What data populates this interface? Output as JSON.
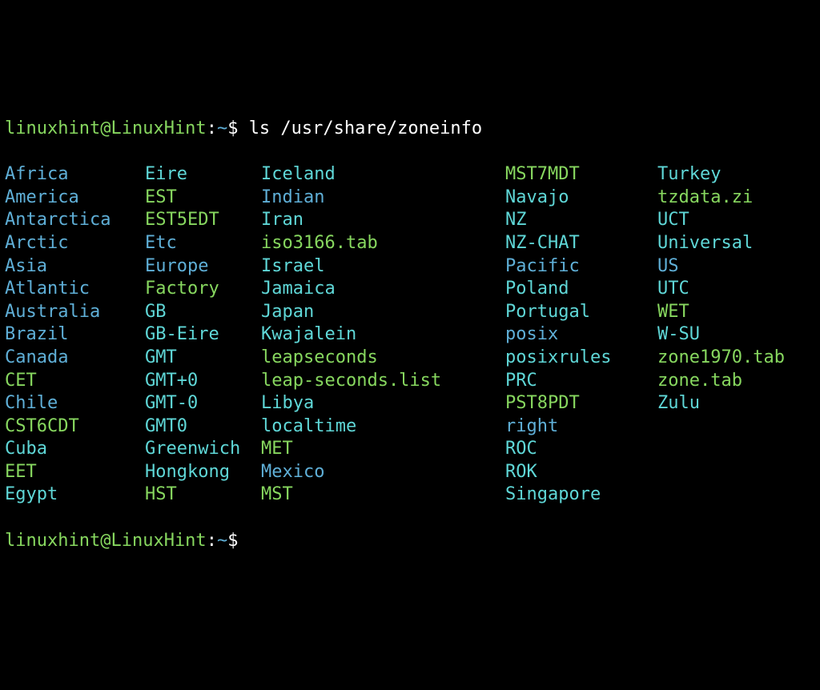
{
  "prompt": {
    "user": "linuxhint",
    "at": "@",
    "host": "LinuxHint",
    "colon": ":",
    "path": "~",
    "dollar": "$ ",
    "command": "ls /usr/share/zoneinfo"
  },
  "prompt2": {
    "user": "linuxhint",
    "at": "@",
    "host": "LinuxHint",
    "colon": ":",
    "path": "~",
    "dollar": "$"
  },
  "r": [
    {
      "c1": {
        "t": "Africa",
        "k": "blue"
      },
      "c2": {
        "t": "Eire",
        "k": "teal"
      },
      "c3": {
        "t": "Iceland",
        "k": "teal"
      },
      "c4": {
        "t": "MST7MDT",
        "k": "green"
      },
      "c5": {
        "t": "Turkey",
        "k": "teal"
      }
    },
    {
      "c1": {
        "t": "America",
        "k": "blue"
      },
      "c2": {
        "t": "EST",
        "k": "green"
      },
      "c3": {
        "t": "Indian",
        "k": "blue"
      },
      "c4": {
        "t": "Navajo",
        "k": "teal"
      },
      "c5": {
        "t": "tzdata.zi",
        "k": "green"
      }
    },
    {
      "c1": {
        "t": "Antarctica",
        "k": "blue"
      },
      "c2": {
        "t": "EST5EDT",
        "k": "green"
      },
      "c3": {
        "t": "Iran",
        "k": "teal"
      },
      "c4": {
        "t": "NZ",
        "k": "teal"
      },
      "c5": {
        "t": "UCT",
        "k": "teal"
      }
    },
    {
      "c1": {
        "t": "Arctic",
        "k": "blue"
      },
      "c2": {
        "t": "Etc",
        "k": "blue"
      },
      "c3": {
        "t": "iso3166.tab",
        "k": "green"
      },
      "c4": {
        "t": "NZ-CHAT",
        "k": "teal"
      },
      "c5": {
        "t": "Universal",
        "k": "teal"
      }
    },
    {
      "c1": {
        "t": "Asia",
        "k": "blue"
      },
      "c2": {
        "t": "Europe",
        "k": "blue"
      },
      "c3": {
        "t": "Israel",
        "k": "teal"
      },
      "c4": {
        "t": "Pacific",
        "k": "blue"
      },
      "c5": {
        "t": "US",
        "k": "blue"
      }
    },
    {
      "c1": {
        "t": "Atlantic",
        "k": "blue"
      },
      "c2": {
        "t": "Factory",
        "k": "green"
      },
      "c3": {
        "t": "Jamaica",
        "k": "teal"
      },
      "c4": {
        "t": "Poland",
        "k": "teal"
      },
      "c5": {
        "t": "UTC",
        "k": "teal"
      }
    },
    {
      "c1": {
        "t": "Australia",
        "k": "blue"
      },
      "c2": {
        "t": "GB",
        "k": "teal"
      },
      "c3": {
        "t": "Japan",
        "k": "teal"
      },
      "c4": {
        "t": "Portugal",
        "k": "teal"
      },
      "c5": {
        "t": "WET",
        "k": "green"
      }
    },
    {
      "c1": {
        "t": "Brazil",
        "k": "blue"
      },
      "c2": {
        "t": "GB-Eire",
        "k": "teal"
      },
      "c3": {
        "t": "Kwajalein",
        "k": "teal"
      },
      "c4": {
        "t": "posix",
        "k": "blue"
      },
      "c5": {
        "t": "W-SU",
        "k": "teal"
      }
    },
    {
      "c1": {
        "t": "Canada",
        "k": "blue"
      },
      "c2": {
        "t": "GMT",
        "k": "teal"
      },
      "c3": {
        "t": "leapseconds",
        "k": "green"
      },
      "c4": {
        "t": "posixrules",
        "k": "teal"
      },
      "c5": {
        "t": "zone1970.tab",
        "k": "green"
      }
    },
    {
      "c1": {
        "t": "CET",
        "k": "green"
      },
      "c2": {
        "t": "GMT+0",
        "k": "teal"
      },
      "c3": {
        "t": "leap-seconds.list",
        "k": "green"
      },
      "c4": {
        "t": "PRC",
        "k": "teal"
      },
      "c5": {
        "t": "zone.tab",
        "k": "green"
      }
    },
    {
      "c1": {
        "t": "Chile",
        "k": "blue"
      },
      "c2": {
        "t": "GMT-0",
        "k": "teal"
      },
      "c3": {
        "t": "Libya",
        "k": "teal"
      },
      "c4": {
        "t": "PST8PDT",
        "k": "green"
      },
      "c5": {
        "t": "Zulu",
        "k": "teal"
      }
    },
    {
      "c1": {
        "t": "CST6CDT",
        "k": "green"
      },
      "c2": {
        "t": "GMT0",
        "k": "teal"
      },
      "c3": {
        "t": "localtime",
        "k": "teal"
      },
      "c4": {
        "t": "right",
        "k": "blue"
      },
      "c5": {
        "t": "",
        "k": "white"
      }
    },
    {
      "c1": {
        "t": "Cuba",
        "k": "teal"
      },
      "c2": {
        "t": "Greenwich",
        "k": "teal"
      },
      "c3": {
        "t": "MET",
        "k": "green"
      },
      "c4": {
        "t": "ROC",
        "k": "teal"
      },
      "c5": {
        "t": "",
        "k": "white"
      }
    },
    {
      "c1": {
        "t": "EET",
        "k": "green"
      },
      "c2": {
        "t": "Hongkong",
        "k": "teal"
      },
      "c3": {
        "t": "Mexico",
        "k": "blue"
      },
      "c4": {
        "t": "ROK",
        "k": "teal"
      },
      "c5": {
        "t": "",
        "k": "white"
      }
    },
    {
      "c1": {
        "t": "Egypt",
        "k": "teal"
      },
      "c2": {
        "t": "HST",
        "k": "green"
      },
      "c3": {
        "t": "MST",
        "k": "green"
      },
      "c4": {
        "t": "Singapore",
        "k": "teal"
      },
      "c5": {
        "t": "",
        "k": "white"
      }
    }
  ]
}
